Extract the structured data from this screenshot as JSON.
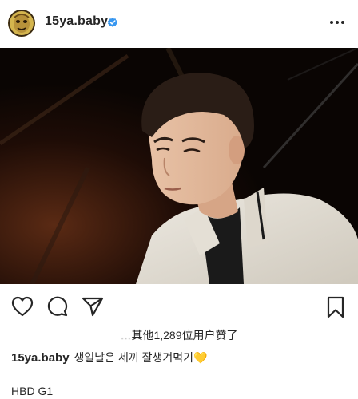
{
  "post": {
    "username": "15ya.baby",
    "verified": true,
    "likes_prefix": "…",
    "likes_text": "其他1,289位用户赞了",
    "caption_user": "15ya.baby",
    "caption_text": "생일날은 세끼 잘챙겨먹기",
    "caption_emoji": "💛",
    "caption_line2": "HBD G1"
  },
  "icons": {
    "verified": "verified-badge-icon",
    "more": "more-options-icon",
    "like": "heart-icon",
    "comment": "comment-icon",
    "share": "send-icon",
    "save": "bookmark-icon"
  },
  "colors": {
    "verified_blue": "#3897f0",
    "text": "#262626"
  }
}
